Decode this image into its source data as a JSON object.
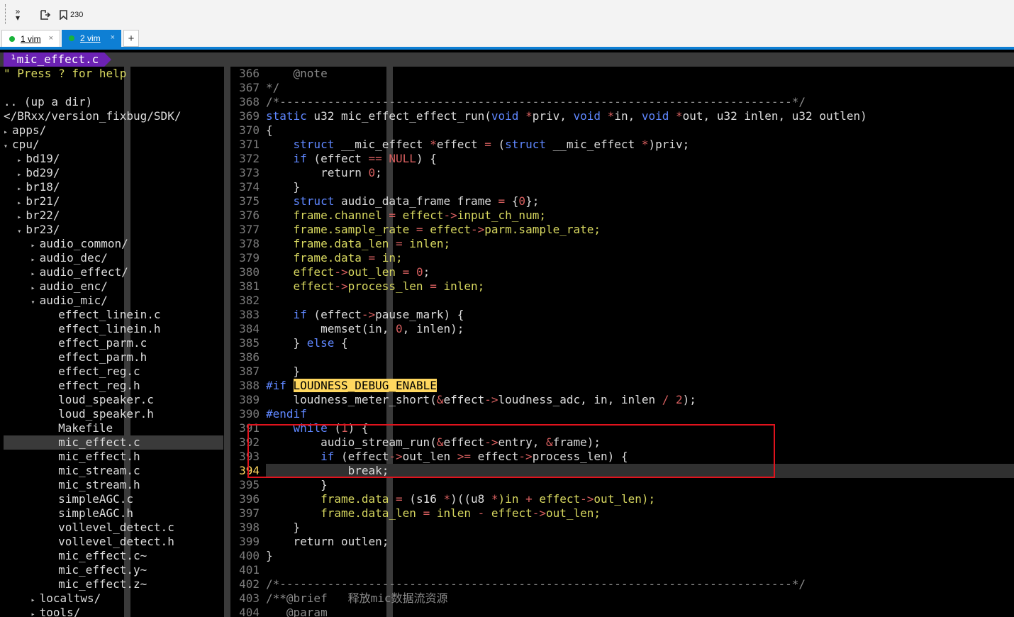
{
  "toolbar": {
    "more_icon": "double-chevron-icon",
    "reconnect_icon": "reconnect-icon",
    "bookmark_icon": "bookmark-icon",
    "bookmark_count": "230"
  },
  "tabs": [
    {
      "label": "1 vim",
      "status_color": "#19b33a",
      "active": false
    },
    {
      "label": "2 vim",
      "status_color": "#19b33a",
      "active": true
    }
  ],
  "tab_add_label": "+",
  "tab_close_label": "×",
  "vim": {
    "buffer_name": "¹mic_effect.c",
    "tree": {
      "help": "\" Press ? for help",
      "lines": [
        {
          "text": ".. (up a dir)",
          "indent": 0,
          "arrow": ""
        },
        {
          "text": "</BRxx/version_fixbug/SDK/",
          "indent": 0,
          "arrow": ""
        },
        {
          "text": "apps/",
          "indent": 0,
          "arrow": "▸"
        },
        {
          "text": "cpu/",
          "indent": 0,
          "arrow": "▾"
        },
        {
          "text": "bd19/",
          "indent": 1,
          "arrow": "▸"
        },
        {
          "text": "bd29/",
          "indent": 1,
          "arrow": "▸"
        },
        {
          "text": "br18/",
          "indent": 1,
          "arrow": "▸"
        },
        {
          "text": "br21/",
          "indent": 1,
          "arrow": "▸"
        },
        {
          "text": "br22/",
          "indent": 1,
          "arrow": "▸"
        },
        {
          "text": "br23/",
          "indent": 1,
          "arrow": "▾"
        },
        {
          "text": "audio_common/",
          "indent": 2,
          "arrow": "▸"
        },
        {
          "text": "audio_dec/",
          "indent": 2,
          "arrow": "▸"
        },
        {
          "text": "audio_effect/",
          "indent": 2,
          "arrow": "▸"
        },
        {
          "text": "audio_enc/",
          "indent": 2,
          "arrow": "▸"
        },
        {
          "text": "audio_mic/",
          "indent": 2,
          "arrow": "▾"
        },
        {
          "text": "effect_linein.c",
          "indent": 3,
          "arrow": ""
        },
        {
          "text": "effect_linein.h",
          "indent": 3,
          "arrow": ""
        },
        {
          "text": "effect_parm.c",
          "indent": 3,
          "arrow": ""
        },
        {
          "text": "effect_parm.h",
          "indent": 3,
          "arrow": ""
        },
        {
          "text": "effect_reg.c",
          "indent": 3,
          "arrow": ""
        },
        {
          "text": "effect_reg.h",
          "indent": 3,
          "arrow": ""
        },
        {
          "text": "loud_speaker.c",
          "indent": 3,
          "arrow": ""
        },
        {
          "text": "loud_speaker.h",
          "indent": 3,
          "arrow": ""
        },
        {
          "text": "Makefile",
          "indent": 3,
          "arrow": ""
        },
        {
          "text": "mic_effect.c",
          "indent": 3,
          "arrow": "",
          "current": true
        },
        {
          "text": "mic_effect.h",
          "indent": 3,
          "arrow": ""
        },
        {
          "text": "mic_stream.c",
          "indent": 3,
          "arrow": ""
        },
        {
          "text": "mic_stream.h",
          "indent": 3,
          "arrow": ""
        },
        {
          "text": "simpleAGC.c",
          "indent": 3,
          "arrow": ""
        },
        {
          "text": "simpleAGC.h",
          "indent": 3,
          "arrow": ""
        },
        {
          "text": "vollevel_detect.c",
          "indent": 3,
          "arrow": ""
        },
        {
          "text": "vollevel_detect.h",
          "indent": 3,
          "arrow": ""
        },
        {
          "text": "mic_effect.c~",
          "indent": 3,
          "arrow": ""
        },
        {
          "text": "mic_effect.y~",
          "indent": 3,
          "arrow": ""
        },
        {
          "text": "mic_effect.z~",
          "indent": 3,
          "arrow": ""
        },
        {
          "text": "localtws/",
          "indent": 2,
          "arrow": "▸"
        },
        {
          "text": "tools/",
          "indent": 2,
          "arrow": "▸"
        }
      ]
    },
    "cursor_line": 394,
    "highlight_box_color": "#e0131d",
    "code": [
      {
        "n": "366",
        "segs": [
          [
            "    @note",
            "cm"
          ]
        ]
      },
      {
        "n": "367",
        "segs": [
          [
            "*/",
            "cm"
          ]
        ]
      },
      {
        "n": "368",
        "segs": [
          [
            "/*---------------------------------------------------------------------------*/",
            "cm"
          ]
        ]
      },
      {
        "n": "369",
        "segs": [
          [
            "static",
            "k"
          ],
          [
            " u32 mic_effect_effect_run(",
            ""
          ],
          [
            "void",
            "k"
          ],
          [
            " ",
            ""
          ],
          [
            "*",
            "o"
          ],
          [
            "priv, ",
            ""
          ],
          [
            "void",
            "k"
          ],
          [
            " ",
            ""
          ],
          [
            "*",
            "o"
          ],
          [
            "in, ",
            ""
          ],
          [
            "void",
            "k"
          ],
          [
            " ",
            ""
          ],
          [
            "*",
            "o"
          ],
          [
            "out, u32 inlen, u32 outlen)",
            ""
          ]
        ]
      },
      {
        "n": "370",
        "segs": [
          [
            "{",
            ""
          ]
        ]
      },
      {
        "n": "371",
        "segs": [
          [
            "    ",
            ""
          ],
          [
            "struct",
            "k"
          ],
          [
            " __mic_effect ",
            ""
          ],
          [
            "*",
            "o"
          ],
          [
            "effect ",
            ""
          ],
          [
            "=",
            "o"
          ],
          [
            " (",
            ""
          ],
          [
            "struct",
            "k"
          ],
          [
            " __mic_effect ",
            ""
          ],
          [
            "*",
            "o"
          ],
          [
            ")priv;",
            ""
          ]
        ]
      },
      {
        "n": "372",
        "segs": [
          [
            "    ",
            ""
          ],
          [
            "if",
            "k"
          ],
          [
            " (effect ",
            ""
          ],
          [
            "==",
            "o"
          ],
          [
            " ",
            ""
          ],
          [
            "NULL",
            "n"
          ],
          [
            ") {",
            ""
          ]
        ]
      },
      {
        "n": "373",
        "segs": [
          [
            "        return ",
            ""
          ],
          [
            "0",
            "n"
          ],
          [
            ";",
            ""
          ]
        ]
      },
      {
        "n": "374",
        "segs": [
          [
            "    }",
            ""
          ]
        ]
      },
      {
        "n": "375",
        "segs": [
          [
            "    ",
            ""
          ],
          [
            "struct",
            "k"
          ],
          [
            " audio_data_frame frame ",
            ""
          ],
          [
            "=",
            "o"
          ],
          [
            " {",
            ""
          ],
          [
            "0",
            "n"
          ],
          [
            "};",
            ""
          ]
        ]
      },
      {
        "n": "376",
        "segs": [
          [
            "    frame.channel ",
            "m"
          ],
          [
            "=",
            "o"
          ],
          [
            " effect",
            "m"
          ],
          [
            "->",
            "o"
          ],
          [
            "input_ch_num;",
            "m"
          ]
        ]
      },
      {
        "n": "377",
        "segs": [
          [
            "    frame.sample_rate ",
            "m"
          ],
          [
            "=",
            "o"
          ],
          [
            " effect",
            "m"
          ],
          [
            "->",
            "o"
          ],
          [
            "parm.sample_rate;",
            "m"
          ]
        ]
      },
      {
        "n": "378",
        "segs": [
          [
            "    frame.data_len ",
            "m"
          ],
          [
            "=",
            "o"
          ],
          [
            " inlen;",
            "m"
          ]
        ]
      },
      {
        "n": "379",
        "segs": [
          [
            "    frame.data ",
            "m"
          ],
          [
            "=",
            "o"
          ],
          [
            " in;",
            "m"
          ]
        ]
      },
      {
        "n": "380",
        "segs": [
          [
            "    effect",
            "m"
          ],
          [
            "->",
            "o"
          ],
          [
            "out_len ",
            "m"
          ],
          [
            "=",
            "o"
          ],
          [
            " ",
            ""
          ],
          [
            "0",
            "n"
          ],
          [
            ";",
            ""
          ]
        ]
      },
      {
        "n": "381",
        "segs": [
          [
            "    effect",
            "m"
          ],
          [
            "->",
            "o"
          ],
          [
            "process_len ",
            "m"
          ],
          [
            "=",
            "o"
          ],
          [
            " inlen;",
            "m"
          ]
        ]
      },
      {
        "n": "382",
        "segs": [
          [
            "",
            ""
          ]
        ]
      },
      {
        "n": "383",
        "segs": [
          [
            "    ",
            ""
          ],
          [
            "if",
            "k"
          ],
          [
            " (effect",
            ""
          ],
          [
            "->",
            "o"
          ],
          [
            "pause_mark) {",
            ""
          ]
        ]
      },
      {
        "n": "384",
        "segs": [
          [
            "        memset(in, ",
            ""
          ],
          [
            "0",
            "n"
          ],
          [
            ", inlen);",
            ""
          ]
        ]
      },
      {
        "n": "385",
        "segs": [
          [
            "    } ",
            ""
          ],
          [
            "else",
            "k"
          ],
          [
            " {",
            ""
          ]
        ]
      },
      {
        "n": "386",
        "segs": [
          [
            "",
            ""
          ]
        ]
      },
      {
        "n": "387",
        "segs": [
          [
            "    }",
            ""
          ]
        ]
      },
      {
        "n": "388",
        "segs": [
          [
            "#if",
            "pp"
          ],
          [
            " ",
            ""
          ],
          [
            "LOUDNESS_DEBUG_ENABLE",
            "hl"
          ]
        ]
      },
      {
        "n": "389",
        "segs": [
          [
            "    loudness_meter_short(",
            ""
          ],
          [
            "&",
            "o"
          ],
          [
            "effect",
            ""
          ],
          [
            "->",
            "o"
          ],
          [
            "loudness_adc, in, inlen ",
            ""
          ],
          [
            "/",
            "o"
          ],
          [
            " ",
            ""
          ],
          [
            "2",
            "n"
          ],
          [
            ");",
            ""
          ]
        ]
      },
      {
        "n": "390",
        "segs": [
          [
            "#endif",
            "pp"
          ]
        ]
      },
      {
        "n": "391",
        "segs": [
          [
            "    ",
            ""
          ],
          [
            "while",
            "k"
          ],
          [
            " (",
            ""
          ],
          [
            "1",
            "n"
          ],
          [
            ") {",
            ""
          ]
        ]
      },
      {
        "n": "392",
        "segs": [
          [
            "        audio_stream_run(",
            ""
          ],
          [
            "&",
            "o"
          ],
          [
            "effect",
            ""
          ],
          [
            "->",
            "o"
          ],
          [
            "entry, ",
            ""
          ],
          [
            "&",
            "o"
          ],
          [
            "frame);",
            ""
          ]
        ]
      },
      {
        "n": "393",
        "segs": [
          [
            "        ",
            ""
          ],
          [
            "if",
            "k"
          ],
          [
            " (effect",
            ""
          ],
          [
            "->",
            "o"
          ],
          [
            "out_len ",
            ""
          ],
          [
            ">=",
            "o"
          ],
          [
            " effect",
            ""
          ],
          [
            "->",
            "o"
          ],
          [
            "process_len) {",
            ""
          ]
        ]
      },
      {
        "n": "394",
        "segs": [
          [
            "            break",
            ""
          ],
          [
            ";",
            "cur"
          ]
        ]
      },
      {
        "n": "395",
        "segs": [
          [
            "        }",
            ""
          ]
        ]
      },
      {
        "n": "396",
        "segs": [
          [
            "        frame.data ",
            "m"
          ],
          [
            "=",
            "o"
          ],
          [
            " (s16 ",
            ""
          ],
          [
            "*",
            "o"
          ],
          [
            ")((u8 ",
            ""
          ],
          [
            "*",
            "o"
          ],
          [
            ")in ",
            "m"
          ],
          [
            "+",
            "o"
          ],
          [
            " effect",
            "m"
          ],
          [
            "->",
            "o"
          ],
          [
            "out_len);",
            "m"
          ]
        ]
      },
      {
        "n": "397",
        "segs": [
          [
            "        frame.data_len ",
            "m"
          ],
          [
            "=",
            "o"
          ],
          [
            " inlen ",
            "m"
          ],
          [
            "-",
            "o"
          ],
          [
            " effect",
            "m"
          ],
          [
            "->",
            "o"
          ],
          [
            "out_len;",
            "m"
          ]
        ]
      },
      {
        "n": "398",
        "segs": [
          [
            "    }",
            ""
          ]
        ]
      },
      {
        "n": "399",
        "segs": [
          [
            "    return outlen;",
            ""
          ]
        ]
      },
      {
        "n": "400",
        "segs": [
          [
            "}",
            ""
          ]
        ]
      },
      {
        "n": "401",
        "segs": [
          [
            "",
            ""
          ]
        ]
      },
      {
        "n": "402",
        "segs": [
          [
            "/*---------------------------------------------------------------------------*/",
            "cm"
          ]
        ]
      },
      {
        "n": "403",
        "segs": [
          [
            "/**@brief   释放mic数据流资源",
            "cm"
          ]
        ]
      },
      {
        "n": "404",
        "segs": [
          [
            "   @param",
            "cm"
          ]
        ]
      }
    ]
  }
}
